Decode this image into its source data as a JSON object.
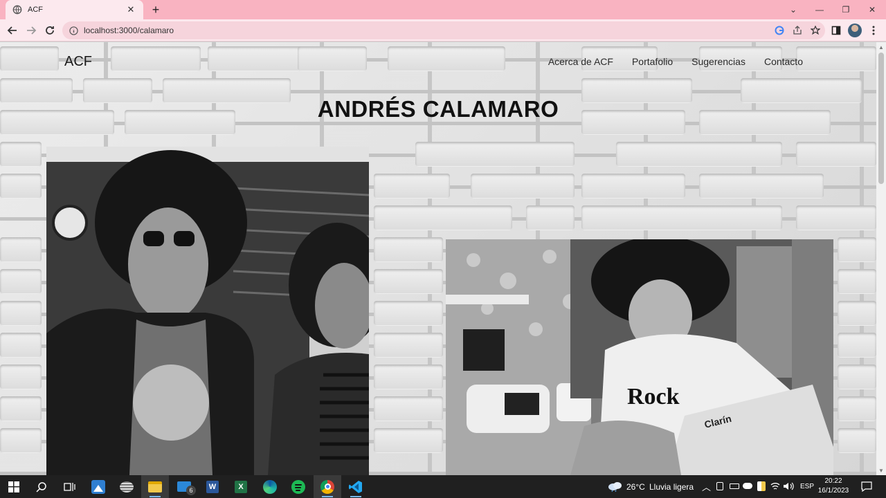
{
  "browser": {
    "tab_title": "ACF",
    "url": "localhost:3000/calamaro"
  },
  "site": {
    "brand": "ACF",
    "nav": [
      {
        "label": "Acerca de ACF"
      },
      {
        "label": "Portafolio"
      },
      {
        "label": "Sugerencias"
      },
      {
        "label": "Contacto"
      }
    ],
    "page_title": "ANDRÉS CALAMARO",
    "photo2_text": {
      "shirt": "Rock",
      "newspaper": "Clarín"
    }
  },
  "taskbar": {
    "weather_temp": "26°C",
    "weather_desc": "Lluvia ligera",
    "language": "ESP",
    "time": "20:22",
    "date": "16/1/2023",
    "mail_badge": "6"
  }
}
